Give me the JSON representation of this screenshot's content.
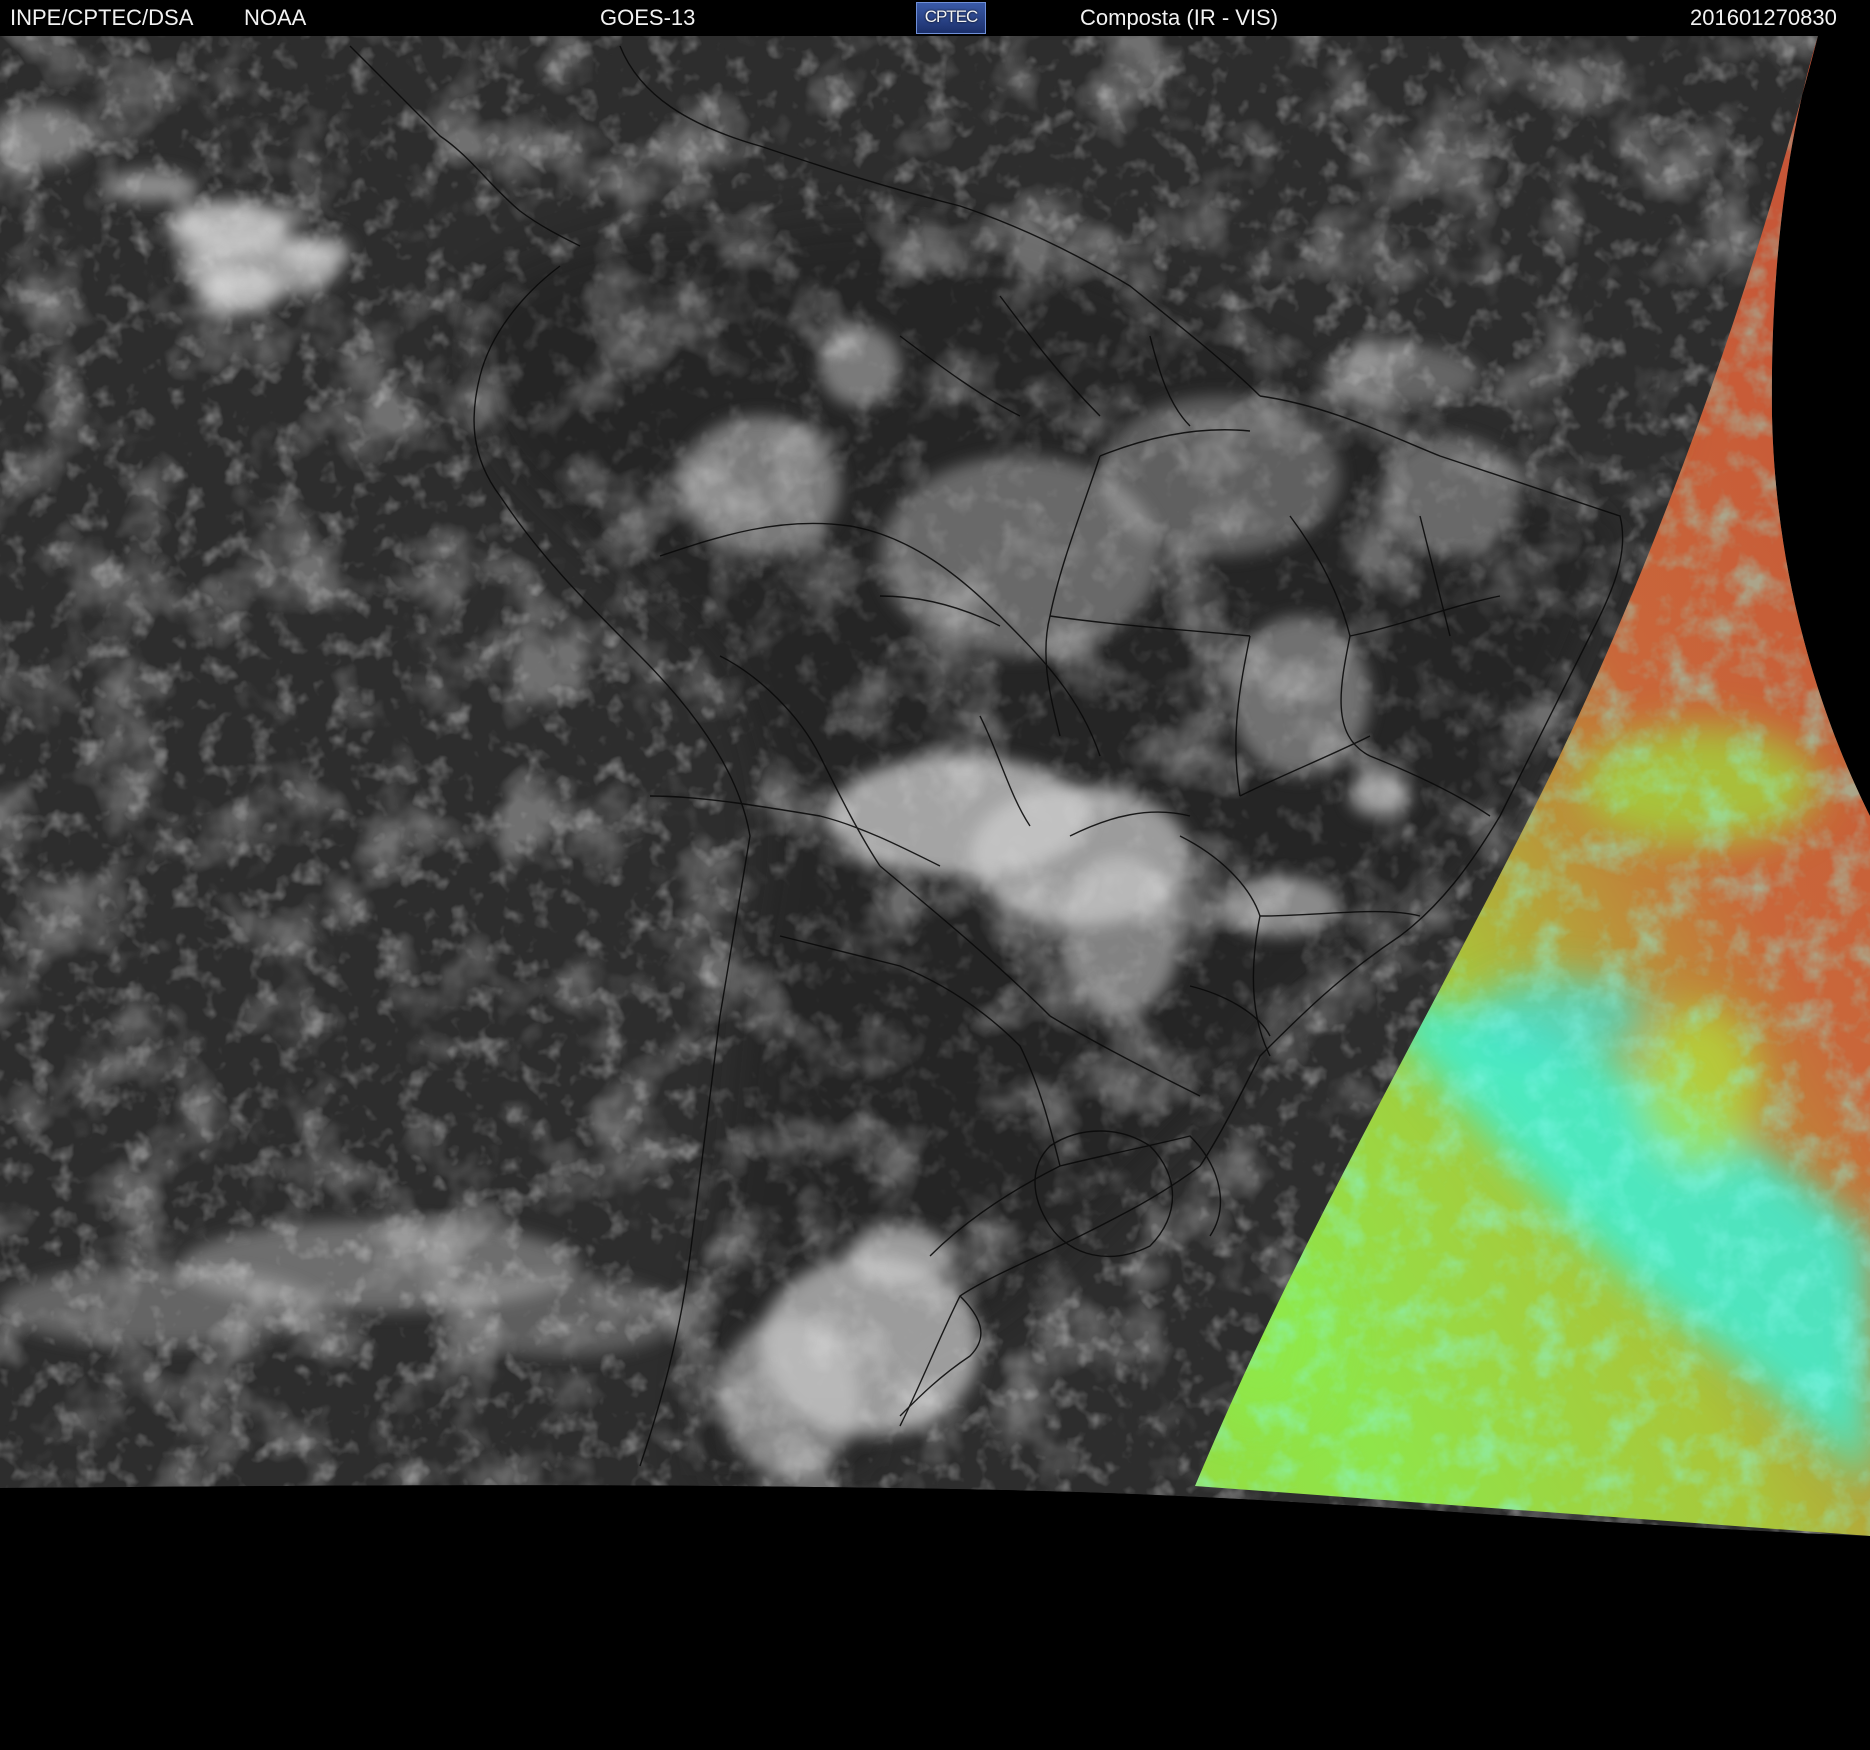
{
  "header": {
    "agency": "INPE/CPTEC/DSA",
    "partner": "NOAA",
    "satellite": "GOES-13",
    "logo_text": "CPTEC",
    "product": "Composta (IR - VIS)",
    "timestamp": "201601270830"
  },
  "colors": {
    "background": "#000000",
    "ocean_ir": "#2b2b2b",
    "cloud": "#d9d9d9",
    "vis_red": "#c8553a",
    "vis_green": "#9be63c",
    "vis_cyan": "#3ff0d8",
    "border_lines": "#000000"
  },
  "map": {
    "region": "South America",
    "layers": [
      "infrared-grayscale",
      "visible-color-composite",
      "country-borders",
      "state-borders"
    ]
  }
}
